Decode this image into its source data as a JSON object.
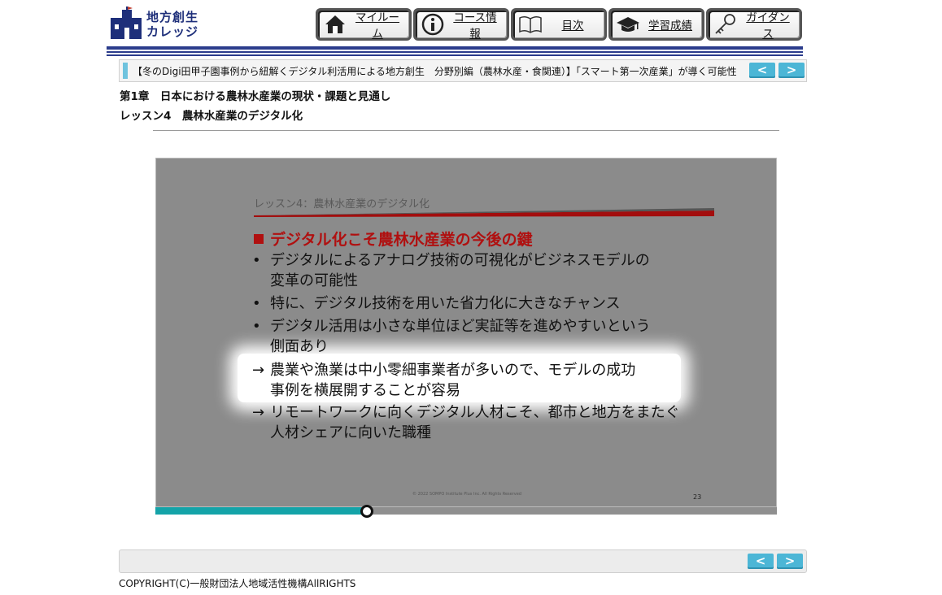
{
  "logo": {
    "line1": "地方創生",
    "line2": "カレッジ"
  },
  "nav": [
    {
      "name": "nav-myroom",
      "label": "マイルーム",
      "icon": "home-icon"
    },
    {
      "name": "nav-course-info",
      "label": "コース情報",
      "icon": "info-icon"
    },
    {
      "name": "nav-toc",
      "label": "目次",
      "icon": "book-icon"
    },
    {
      "name": "nav-grades",
      "label": "学習成績",
      "icon": "graduation-cap-icon"
    },
    {
      "name": "nav-guidance",
      "label": "ガイダンス",
      "icon": "key-icon"
    }
  ],
  "course_title": "【冬のDigi田甲子園事例から紐解くデジタル利活用による地方創生　分野別編（農林水産・食関連）】「スマート第一次産業」が導く可能性",
  "pager": {
    "prev": "<",
    "next": ">"
  },
  "chapter": "第1章　日本における農林水産業の現状・課題と見通し",
  "lesson": "レッスン4　農林水産業のデジタル化",
  "slide": {
    "title": "レッスン4：農林水産業のデジタル化",
    "heading": "デジタル化こそ農林水産業の今後の鍵",
    "bullets": [
      {
        "mark": "•",
        "lines": [
          "デジタルによるアナログ技術の可視化がビジネスモデルの",
          "変革の可能性"
        ]
      },
      {
        "mark": "•",
        "lines": [
          "特に、デジタル技術を用いた省力化に大きなチャンス"
        ]
      },
      {
        "mark": "•",
        "lines": [
          "デジタル活用は小さな単位ほど実証等を進めやすいという",
          "側面あり"
        ]
      },
      {
        "mark": "→",
        "lines": [
          "農業や漁業は中小零細事業者が多いので、モデルの成功",
          "事例を横展開することが容易"
        ]
      },
      {
        "mark": "→",
        "lines": [
          "リモートワークに向くデジタル人材こそ、都市と地方をまたぐ",
          "人材シェアに向いた職種"
        ]
      }
    ],
    "footer": "© 2022 SOMPO Institute Plus Inc. All Rights Reserved",
    "page_number": "23"
  },
  "progress": {
    "fraction": 0.34
  },
  "copyright": "COPYRIGHT(C)一般財団法人地域活性機構AllRIGHTS",
  "colors": {
    "accent": "#4cb6d6",
    "progress": "#14a3a8",
    "slide_red": "#b01010",
    "navy": "#1e2f7a"
  }
}
